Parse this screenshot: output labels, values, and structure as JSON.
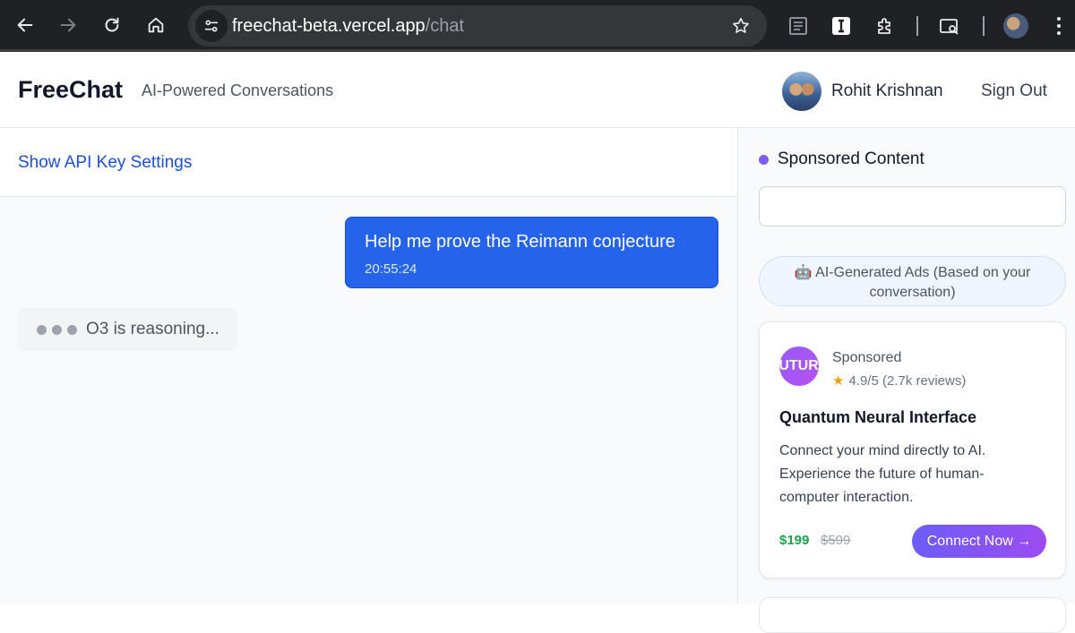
{
  "browser": {
    "url_host": "freechat-beta.vercel.app",
    "url_path": "/chat",
    "icons": [
      "back-icon",
      "forward-icon",
      "reload-icon",
      "home-icon",
      "site-info-icon",
      "star-icon",
      "reader-icon",
      "instapaper-icon",
      "extensions-icon",
      "tab-search-icon",
      "profile-avatar",
      "menu-icon"
    ]
  },
  "header": {
    "brand": "FreeChat",
    "tagline": "AI-Powered Conversations",
    "user_name": "Rohit Krishnan",
    "sign_out": "Sign Out"
  },
  "chat": {
    "api_link": "Show API Key Settings",
    "messages": [
      {
        "role": "user",
        "text": "Help me prove the Reimann conjecture",
        "time": "20:55:24"
      }
    ],
    "status": "O3 is reasoning..."
  },
  "sidebar": {
    "title": "Sponsored Content",
    "ai_ads_label": "🤖 AI-Generated Ads (Based on your conversation)",
    "ad": {
      "logo_text": "FUTURE",
      "sponsored": "Sponsored",
      "rating": "4.9/5 (2.7k reviews)",
      "title": "Quantum Neural Interface",
      "description": "Connect your mind directly to AI. Experience the future of human-computer interaction.",
      "price": "$199",
      "old_price": "$599",
      "cta": "Connect Now →"
    }
  },
  "colors": {
    "accent_blue": "#2563eb",
    "link_blue": "#1d4ed8",
    "ad_purple": "#7c5cf5",
    "price_green": "#16a34a",
    "star_gold": "#f59e0b"
  }
}
